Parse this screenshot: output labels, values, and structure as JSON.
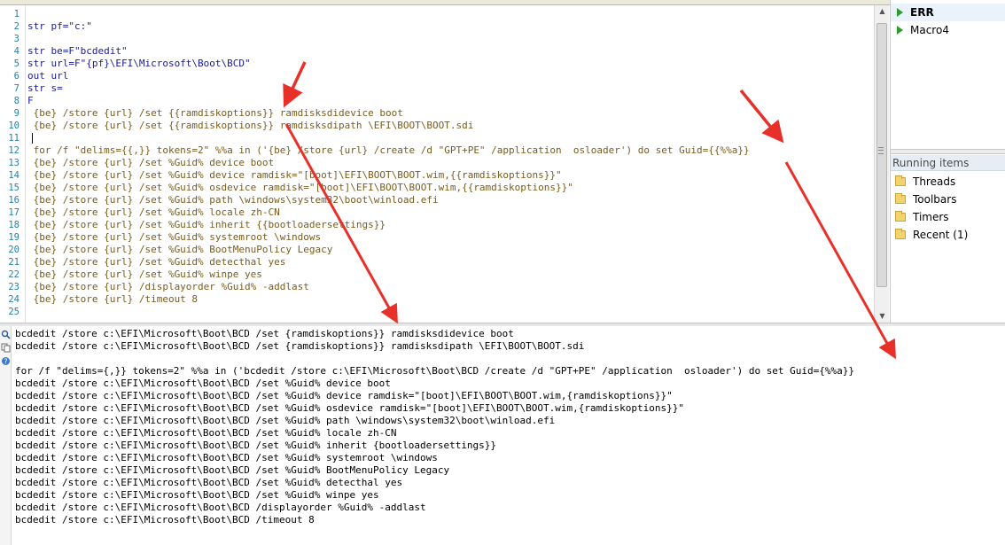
{
  "editor": {
    "lines": [
      {
        "n": "1",
        "text": "",
        "kw": false
      },
      {
        "n": "2",
        "text": "str pf=\"c:\"",
        "kw": true
      },
      {
        "n": "3",
        "text": "",
        "kw": false
      },
      {
        "n": "4",
        "text": "str be=F\"bcdedit\"",
        "kw": true
      },
      {
        "n": "5",
        "text": "str url=F\"{pf}\\EFI\\Microsoft\\Boot\\BCD\"",
        "kw": true
      },
      {
        "n": "6",
        "text": "out url",
        "kw": true
      },
      {
        "n": "7",
        "text": "str s=",
        "kw": true
      },
      {
        "n": "8",
        "text": "F",
        "kw": true
      },
      {
        "n": "9",
        "text": " {be} /store {url} /set {{ramdiskoptions}} ramdisksdidevice boot",
        "kw": false
      },
      {
        "n": "10",
        "text": " {be} /store {url} /set {{ramdiskoptions}} ramdisksdipath \\EFI\\BOOT\\BOOT.sdi",
        "kw": false
      },
      {
        "n": "11",
        "text": "",
        "kw": false
      },
      {
        "n": "12",
        "text": " for /f \"delims={{,}} tokens=2\" %%a in ('{be} /store {url} /create /d \"GPT+PE\" /application  osloader') do set Guid={{%%a}}",
        "kw": false
      },
      {
        "n": "13",
        "text": " {be} /store {url} /set %Guid% device boot",
        "kw": false
      },
      {
        "n": "14",
        "text": " {be} /store {url} /set %Guid% device ramdisk=\"[boot]\\EFI\\BOOT\\BOOT.wim,{{ramdiskoptions}}\"",
        "kw": false
      },
      {
        "n": "15",
        "text": " {be} /store {url} /set %Guid% osdevice ramdisk=\"[boot]\\EFI\\BOOT\\BOOT.wim,{{ramdiskoptions}}\"",
        "kw": false
      },
      {
        "n": "16",
        "text": " {be} /store {url} /set %Guid% path \\windows\\system32\\boot\\winload.efi",
        "kw": false
      },
      {
        "n": "17",
        "text": " {be} /store {url} /set %Guid% locale zh-CN",
        "kw": false
      },
      {
        "n": "18",
        "text": " {be} /store {url} /set %Guid% inherit {{bootloadersettings}}",
        "kw": false
      },
      {
        "n": "19",
        "text": " {be} /store {url} /set %Guid% systemroot \\windows",
        "kw": false
      },
      {
        "n": "20",
        "text": " {be} /store {url} /set %Guid% BootMenuPolicy Legacy",
        "kw": false
      },
      {
        "n": "21",
        "text": " {be} /store {url} /set %Guid% detecthal yes",
        "kw": false
      },
      {
        "n": "22",
        "text": " {be} /store {url} /set %Guid% winpe yes",
        "kw": false
      },
      {
        "n": "23",
        "text": " {be} /store {url} /displayorder %Guid% -addlast",
        "kw": false
      },
      {
        "n": "24",
        "text": " {be} /store {url} /timeout 8",
        "kw": false
      },
      {
        "n": "25",
        "text": "",
        "kw": false
      }
    ]
  },
  "macros": {
    "items": [
      {
        "label": "ERR",
        "selected": true
      },
      {
        "label": "Macro4",
        "selected": false
      }
    ]
  },
  "running": {
    "header": "Running items",
    "items": [
      "Threads",
      "Toolbars",
      "Timers",
      "Recent (1)"
    ]
  },
  "output": {
    "lines": [
      "bcdedit /store c:\\EFI\\Microsoft\\Boot\\BCD /set {ramdiskoptions}} ramdisksdidevice boot",
      "bcdedit /store c:\\EFI\\Microsoft\\Boot\\BCD /set {ramdiskoptions}} ramdisksdipath \\EFI\\BOOT\\BOOT.sdi",
      "",
      "for /f \"delims={,}} tokens=2\" %%a in ('bcdedit /store c:\\EFI\\Microsoft\\Boot\\BCD /create /d \"GPT+PE\" /application  osloader') do set Guid={%%a}}",
      "bcdedit /store c:\\EFI\\Microsoft\\Boot\\BCD /set %Guid% device boot",
      "bcdedit /store c:\\EFI\\Microsoft\\Boot\\BCD /set %Guid% device ramdisk=\"[boot]\\EFI\\BOOT\\BOOT.wim,{ramdiskoptions}}\"",
      "bcdedit /store c:\\EFI\\Microsoft\\Boot\\BCD /set %Guid% osdevice ramdisk=\"[boot]\\EFI\\BOOT\\BOOT.wim,{ramdiskoptions}}\"",
      "bcdedit /store c:\\EFI\\Microsoft\\Boot\\BCD /set %Guid% path \\windows\\system32\\boot\\winload.efi",
      "bcdedit /store c:\\EFI\\Microsoft\\Boot\\BCD /set %Guid% locale zh-CN",
      "bcdedit /store c:\\EFI\\Microsoft\\Boot\\BCD /set %Guid% inherit {bootloadersettings}}",
      "bcdedit /store c:\\EFI\\Microsoft\\Boot\\BCD /set %Guid% systemroot \\windows",
      "bcdedit /store c:\\EFI\\Microsoft\\Boot\\BCD /set %Guid% BootMenuPolicy Legacy",
      "bcdedit /store c:\\EFI\\Microsoft\\Boot\\BCD /set %Guid% detecthal yes",
      "bcdedit /store c:\\EFI\\Microsoft\\Boot\\BCD /set %Guid% winpe yes",
      "bcdedit /store c:\\EFI\\Microsoft\\Boot\\BCD /displayorder %Guid% -addlast",
      "bcdedit /store c:\\EFI\\Microsoft\\Boot\\BCD /timeout 8"
    ]
  },
  "colors": {
    "annotation_arrow": "#e8302a",
    "line_number": "#2b7fa8",
    "string_text": "#7a5c1c",
    "keyword": "#1a1a9c",
    "macro_triangle": "#2e9b2e"
  }
}
